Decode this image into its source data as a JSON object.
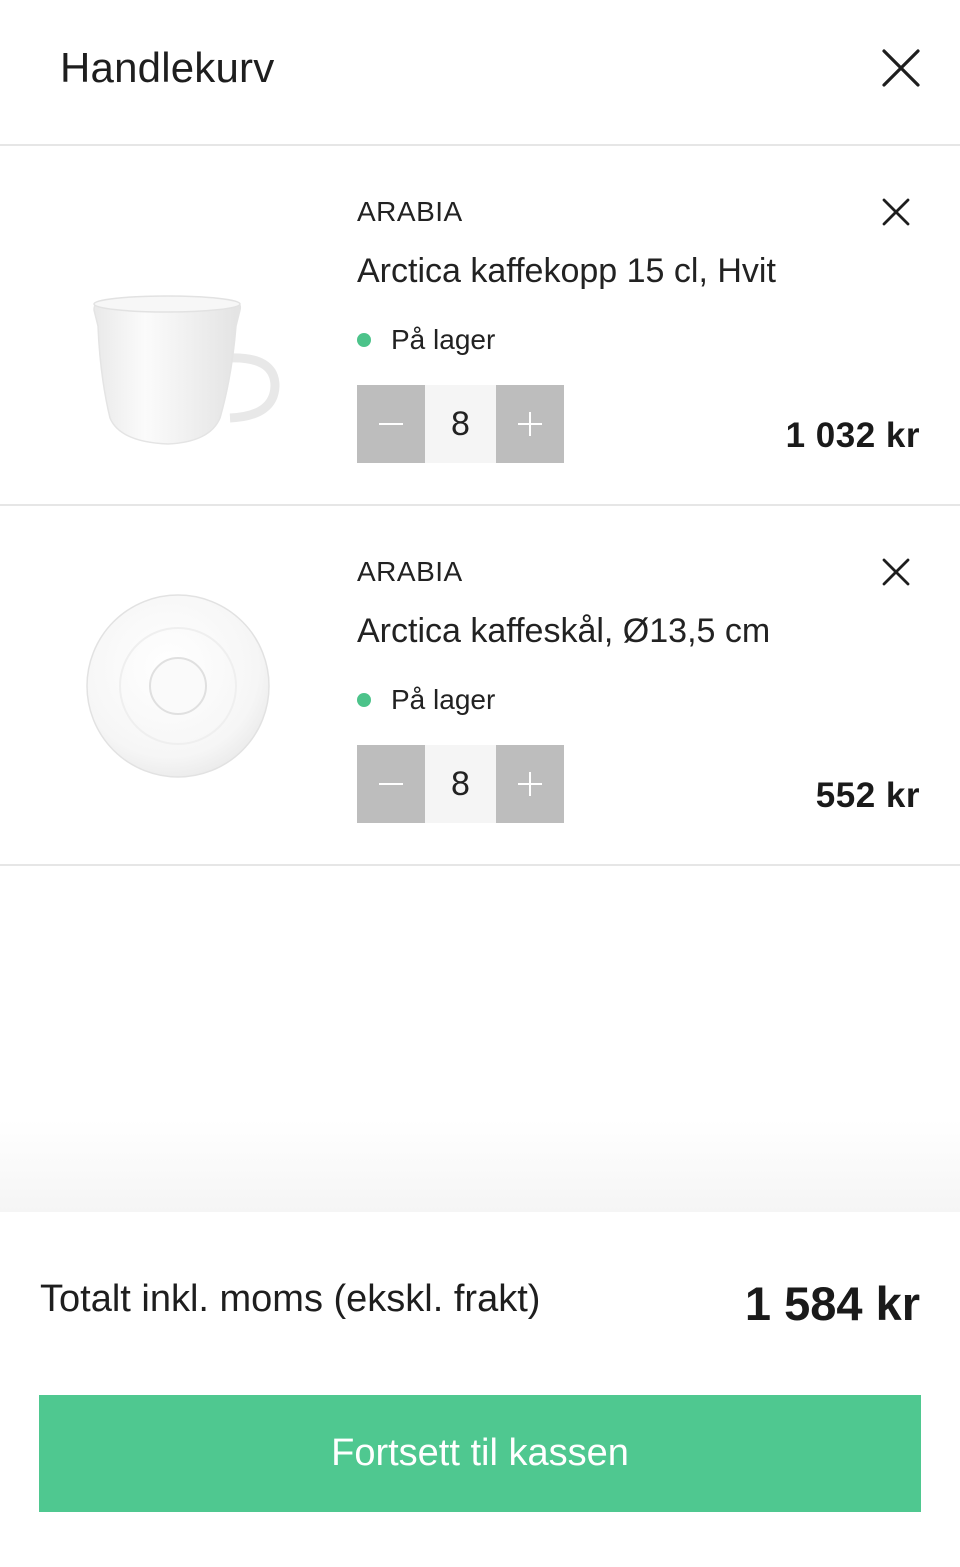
{
  "header": {
    "title": "Handlekurv",
    "close_icon": "close-icon"
  },
  "items": [
    {
      "brand": "ARABIA",
      "name": "Arctica kaffekopp 15 cl, Hvit",
      "stock": "På lager",
      "quantity": "8",
      "price": "1 032 kr",
      "image": "coffee-cup-image"
    },
    {
      "brand": "ARABIA",
      "name": "Arctica kaffeskål, Ø13,5 cm",
      "stock": "På lager",
      "quantity": "8",
      "price": "552 kr",
      "image": "saucer-image"
    }
  ],
  "footer": {
    "total_label": "Totalt inkl. moms (ekskl. frakt)",
    "total_value": "1 584 kr",
    "checkout_label": "Fortsett til kassen"
  },
  "colors": {
    "accent": "#4fc890",
    "stock_dot": "#4cc38a",
    "qty_button": "#bdbdbd",
    "divider": "#e6e6e6"
  }
}
